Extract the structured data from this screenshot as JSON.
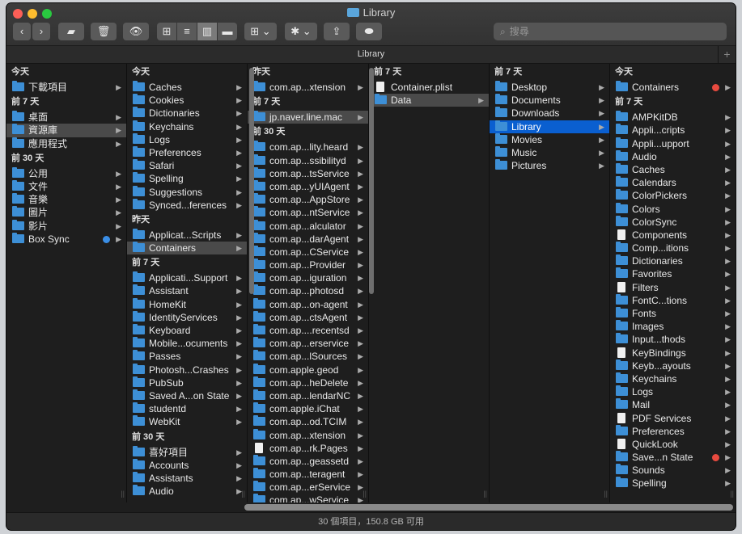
{
  "window": {
    "title": "Library"
  },
  "toolbar": {
    "back": "‹",
    "forward": "›",
    "folder_icon": "folder-icon",
    "trash": "🗑",
    "eye": "👁",
    "view_icon": "⊞",
    "view_list": "≡",
    "view_columns": "▥",
    "view_gallery": "▬",
    "group": "⊞ ⌄",
    "action": "✱ ⌄",
    "share": "⇪",
    "tag": "⬬",
    "search_placeholder": "搜尋"
  },
  "pathbar": {
    "title": "Library",
    "plus": "+"
  },
  "columns": [
    {
      "sections": [
        {
          "header": "今天",
          "items": [
            {
              "label": "下載項目",
              "arrow": true
            }
          ]
        },
        {
          "header": "前 7 天",
          "items": [
            {
              "label": "桌面",
              "arrow": true
            },
            {
              "label": "資源庫",
              "arrow": true,
              "state": "hl"
            },
            {
              "label": "應用程式",
              "arrow": true
            }
          ]
        },
        {
          "header": "前 30 天",
          "items": [
            {
              "label": "公用",
              "arrow": true
            },
            {
              "label": "文件",
              "arrow": true
            },
            {
              "label": "音樂",
              "arrow": true
            },
            {
              "label": "圖片",
              "arrow": true
            },
            {
              "label": "影片",
              "arrow": true
            },
            {
              "label": "Box Sync",
              "arrow": true,
              "badge": "blue"
            }
          ]
        }
      ]
    },
    {
      "sections": [
        {
          "header": "今天",
          "items": [
            {
              "label": "Caches",
              "arrow": true
            },
            {
              "label": "Cookies",
              "arrow": true
            },
            {
              "label": "Dictionaries",
              "arrow": true
            },
            {
              "label": "Keychains",
              "arrow": true
            },
            {
              "label": "Logs",
              "arrow": true
            },
            {
              "label": "Preferences",
              "arrow": true
            },
            {
              "label": "Safari",
              "arrow": true
            },
            {
              "label": "Spelling",
              "arrow": true
            },
            {
              "label": "Suggestions",
              "arrow": true
            },
            {
              "label": "Synced...ferences",
              "arrow": true
            }
          ]
        },
        {
          "header": "昨天",
          "items": [
            {
              "label": "Applicat...Scripts",
              "arrow": true
            },
            {
              "label": "Containers",
              "arrow": true,
              "state": "hl"
            }
          ]
        },
        {
          "header": "前 7 天",
          "items": [
            {
              "label": "Applicati...Support",
              "arrow": true
            },
            {
              "label": "Assistant",
              "arrow": true
            },
            {
              "label": "HomeKit",
              "arrow": true
            },
            {
              "label": "IdentityServices",
              "arrow": true
            },
            {
              "label": "Keyboard",
              "arrow": true
            },
            {
              "label": "Mobile...ocuments",
              "arrow": true
            },
            {
              "label": "Passes",
              "arrow": true
            },
            {
              "label": "Photosh...Crashes",
              "arrow": true
            },
            {
              "label": "PubSub",
              "arrow": true
            },
            {
              "label": "Saved A...on State",
              "arrow": true
            },
            {
              "label": "studentd",
              "arrow": true
            },
            {
              "label": "WebKit",
              "arrow": true
            }
          ]
        },
        {
          "header": "前 30 天",
          "items": [
            {
              "label": "喜好項目",
              "arrow": true
            },
            {
              "label": "Accounts",
              "arrow": true
            },
            {
              "label": "Assistants",
              "arrow": true
            },
            {
              "label": "Audio",
              "arrow": true
            }
          ]
        }
      ]
    },
    {
      "sections": [
        {
          "header": "昨天",
          "items": [
            {
              "label": "com.ap...xtension",
              "arrow": true
            }
          ]
        },
        {
          "header": "前 7 天",
          "items": [
            {
              "label": "jp.naver.line.mac",
              "arrow": true,
              "state": "hl"
            }
          ]
        },
        {
          "header": "前 30 天",
          "items": [
            {
              "label": "com.ap...lity.heard",
              "arrow": true
            },
            {
              "label": "com.ap...ssibilityd",
              "arrow": true
            },
            {
              "label": "com.ap...tsService",
              "arrow": true
            },
            {
              "label": "com.ap...yUIAgent",
              "arrow": true
            },
            {
              "label": "com.ap...AppStore",
              "arrow": true
            },
            {
              "label": "com.ap...ntService",
              "arrow": true
            },
            {
              "label": "com.ap...alculator",
              "arrow": true
            },
            {
              "label": "com.ap...darAgent",
              "arrow": true
            },
            {
              "label": "com.ap...CService",
              "arrow": true
            },
            {
              "label": "com.ap...Provider",
              "arrow": true
            },
            {
              "label": "com.ap...iguration",
              "arrow": true
            },
            {
              "label": "com.ap...photosd",
              "arrow": true
            },
            {
              "label": "com.ap...on-agent",
              "arrow": true
            },
            {
              "label": "com.ap...ctsAgent",
              "arrow": true
            },
            {
              "label": "com.ap....recentsd",
              "arrow": true
            },
            {
              "label": "com.ap...erservice",
              "arrow": true
            },
            {
              "label": "com.ap...lSources",
              "arrow": true
            },
            {
              "label": "com.apple.geod",
              "arrow": true
            },
            {
              "label": "com.ap...heDelete",
              "arrow": true
            },
            {
              "label": "com.ap...lendarNC",
              "arrow": true
            },
            {
              "label": "com.apple.iChat",
              "arrow": true
            },
            {
              "label": "com.ap...od.TCIM",
              "arrow": true
            },
            {
              "label": "com.ap...xtension",
              "arrow": true
            },
            {
              "label": "com.ap...rk.Pages",
              "arrow": true,
              "file": true
            },
            {
              "label": "com.ap...geassetd",
              "arrow": true
            },
            {
              "label": "com.ap...teragent",
              "arrow": true
            },
            {
              "label": "com.ap...erService",
              "arrow": true
            },
            {
              "label": "com.ap...wService",
              "arrow": true
            }
          ]
        }
      ]
    },
    {
      "sections": [
        {
          "header": "前 7 天",
          "items": [
            {
              "label": "Container.plist",
              "arrow": false,
              "file": true
            },
            {
              "label": "Data",
              "arrow": true,
              "state": "hl"
            }
          ]
        }
      ]
    },
    {
      "sections": [
        {
          "header": "前 7 天",
          "items": [
            {
              "label": "Desktop",
              "arrow": true
            },
            {
              "label": "Documents",
              "arrow": true
            },
            {
              "label": "Downloads",
              "arrow": true
            },
            {
              "label": "Library",
              "arrow": true,
              "state": "sel"
            },
            {
              "label": "Movies",
              "arrow": true
            },
            {
              "label": "Music",
              "arrow": true
            },
            {
              "label": "Pictures",
              "arrow": true
            }
          ]
        }
      ]
    },
    {
      "sections": [
        {
          "header": "今天",
          "items": [
            {
              "label": "Containers",
              "arrow": true,
              "badge": "red"
            }
          ]
        },
        {
          "header": "前 7 天",
          "items": [
            {
              "label": "AMPKitDB",
              "arrow": true
            },
            {
              "label": "Appli...cripts",
              "arrow": true
            },
            {
              "label": "Appli...upport",
              "arrow": true
            },
            {
              "label": "Audio",
              "arrow": true
            },
            {
              "label": "Caches",
              "arrow": true
            },
            {
              "label": "Calendars",
              "arrow": true
            },
            {
              "label": "ColorPickers",
              "arrow": true
            },
            {
              "label": "Colors",
              "arrow": true
            },
            {
              "label": "ColorSync",
              "arrow": true
            },
            {
              "label": "Components",
              "arrow": true,
              "file": true
            },
            {
              "label": "Comp...itions",
              "arrow": true
            },
            {
              "label": "Dictionaries",
              "arrow": true
            },
            {
              "label": "Favorites",
              "arrow": true
            },
            {
              "label": "Filters",
              "arrow": true,
              "file": true
            },
            {
              "label": "FontC...tions",
              "arrow": true
            },
            {
              "label": "Fonts",
              "arrow": true
            },
            {
              "label": "Images",
              "arrow": true
            },
            {
              "label": "Input...thods",
              "arrow": true
            },
            {
              "label": "KeyBindings",
              "arrow": true,
              "file": true
            },
            {
              "label": "Keyb...ayouts",
              "arrow": true
            },
            {
              "label": "Keychains",
              "arrow": true
            },
            {
              "label": "Logs",
              "arrow": true
            },
            {
              "label": "Mail",
              "arrow": true
            },
            {
              "label": "PDF Services",
              "arrow": true,
              "file": true
            },
            {
              "label": "Preferences",
              "arrow": true
            },
            {
              "label": "QuickLook",
              "arrow": true,
              "file": true
            },
            {
              "label": "Save...n State",
              "arrow": true,
              "badge": "red"
            },
            {
              "label": "Sounds",
              "arrow": true
            },
            {
              "label": "Spelling",
              "arrow": true
            }
          ]
        }
      ]
    }
  ],
  "status": {
    "text": "30 個項目，150.8 GB 可用"
  }
}
